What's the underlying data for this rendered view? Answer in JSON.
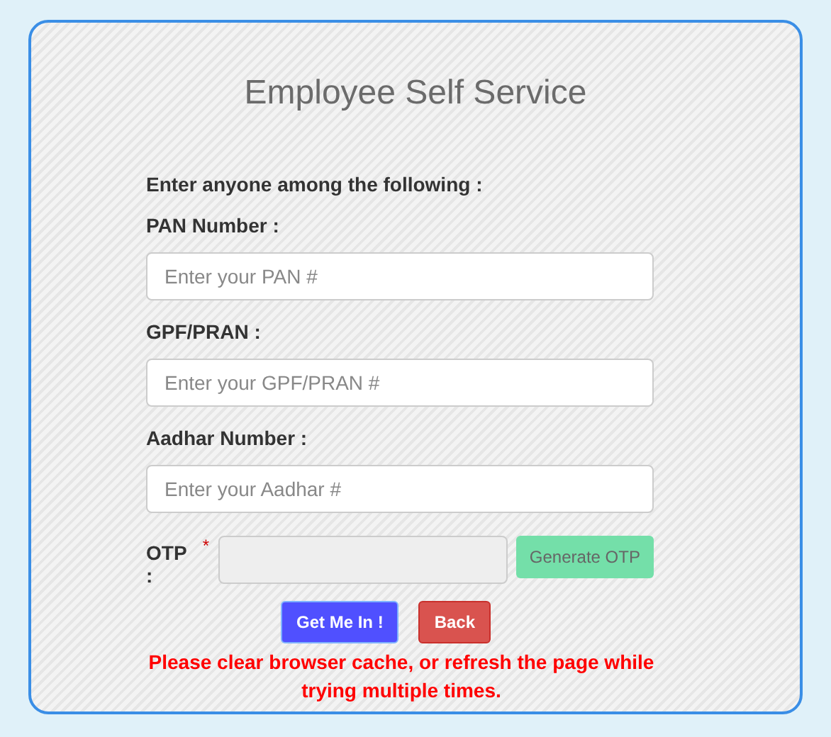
{
  "title": "Employee Self Service",
  "instruction": "Enter anyone among the following :",
  "fields": [
    {
      "label": "PAN Number :",
      "placeholder": "Enter your PAN #"
    },
    {
      "label": "GPF/PRAN :",
      "placeholder": "Enter your GPF/PRAN #"
    },
    {
      "label": "Aadhar Number :",
      "placeholder": "Enter your Aadhar #"
    }
  ],
  "otp": {
    "label": "OTP :",
    "required_mark": "*",
    "disabled": true,
    "generate_button": {
      "label": "Generate OTP",
      "disabled": true
    }
  },
  "buttons": [
    {
      "label": "Get Me In !",
      "kind": "primary"
    },
    {
      "label": "Back",
      "kind": "danger"
    }
  ],
  "notice": "Please clear browser cache, or refresh the page while trying multiple times."
}
